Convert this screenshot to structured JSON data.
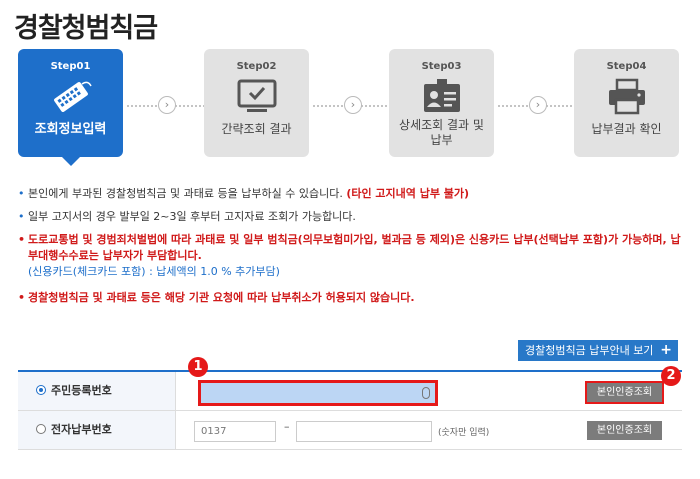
{
  "page_title": "경찰청범칙금",
  "steps": [
    {
      "num": "Step01",
      "label": "조회정보입력",
      "icon": "keyboard-icon",
      "active": true
    },
    {
      "num": "Step02",
      "label": "간략조회 결과",
      "icon": "monitor-check-icon",
      "active": false
    },
    {
      "num": "Step03",
      "label": "상세조회 결과 및 납부",
      "icon": "id-card-icon",
      "active": false
    },
    {
      "num": "Step04",
      "label": "납부결과 확인",
      "icon": "printer-icon",
      "active": false
    }
  ],
  "step_arrow": "›",
  "notes": {
    "n1_text": "본인에게 부과된 경찰청범칙금 및 과태료 등을 납부하실 수 있습니다.",
    "n1_emph": "(타인 고지내역 납부 불가)",
    "n2": "일부 고지서의 경우 발부일 2~3일 후부터 고지자료 조회가 가능합니다.",
    "n3_main": "도로교통법 및 경범죄처벌법에 따라 과태료 및 일부 범칙금(의무보험미가입, 벌과금 등 제외)은 신용카드 납부(선택납부 포함)가 가능하며, 납부대행수수료는 납부자가 부담합니다.",
    "n3_sub": "(신용카드(체크카드 포함) : 납세액의 1.0 % 추가부담)",
    "n4": "경찰청범칙금 및 과태료 등은 해당 기관 요청에 따라 납부취소가 허용되지 않습니다."
  },
  "guide_button": {
    "label": "경찰청범칙금 납부안내 보기",
    "plus": "+"
  },
  "form": {
    "row1": {
      "label": "주민등록번호",
      "auth_label": "본인인증조회",
      "selected": true
    },
    "row2": {
      "label": "전자납부번호",
      "prefix_value": "0137",
      "dash": "–",
      "hint": "(숫자만 입력)",
      "auth_label": "본인인증조회",
      "selected": false
    }
  },
  "badges": {
    "b1": "1",
    "b2": "2"
  },
  "colors": {
    "primary": "#1e6fca",
    "highlight": "#e51919",
    "button_gray": "#7c7c7c"
  }
}
